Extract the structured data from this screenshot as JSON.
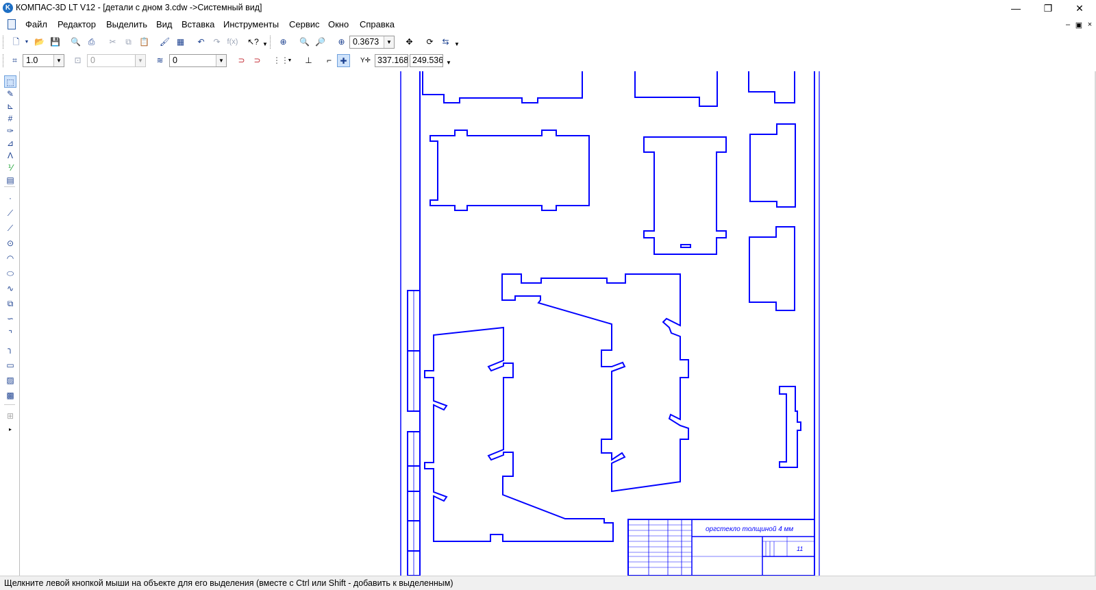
{
  "window": {
    "app_icon": "kompas-k-icon",
    "title": "КОМПАС-3D LT V12 - [детали с дном 3.cdw ->Системный вид]",
    "minimize": "—",
    "restore": "❐",
    "close": "✕"
  },
  "menu": {
    "items": [
      "Файл",
      "Редактор",
      "Выделить",
      "Вид",
      "Вставка",
      "Инструменты",
      "Сервис",
      "Окно",
      "Справка"
    ],
    "doc_controls": [
      "‒",
      "▣",
      "×"
    ]
  },
  "toolbar1": {
    "zoom_value": "0.3673",
    "buttons": [
      "new-document",
      "open",
      "save",
      "print-preview",
      "print",
      "cut",
      "copy",
      "paste",
      "format-painter",
      "variables",
      "undo",
      "redo",
      "function",
      "help-pointer",
      "zoom-window",
      "zoom-in",
      "zoom-out",
      "zoom-scale",
      "pan",
      "refresh-view",
      "rebuild"
    ]
  },
  "toolbar2": {
    "step_value": "1.0",
    "angle_value": "0",
    "layer_value": "0",
    "coord_x": "337.168",
    "coord_y": "249.536",
    "buttons": [
      "step-cursor",
      "layer",
      "current-layer",
      "snap-global",
      "snap-local",
      "grid",
      "ortho",
      "local-cs",
      "round",
      "snap-active"
    ]
  },
  "left_toolbar": {
    "tools": [
      "select",
      "geometry",
      "dimensions",
      "designations",
      "edit",
      "parametrization",
      "measure",
      "filter",
      "spec",
      "point",
      "auxiliary-line",
      "segment",
      "circle",
      "arc",
      "ellipse",
      "nurbs",
      "polyline",
      "bezier",
      "chamfer",
      "fillet",
      "rectangle",
      "hatch",
      "fill",
      "disabled-tool"
    ]
  },
  "drawing": {
    "title_block_note": "оргстекло толщиной 4 мм",
    "sheet_number": "11",
    "line_color": "#0000ff"
  },
  "status": {
    "hint": "Щелкните левой кнопкой мыши на объекте для его выделения (вместе с Ctrl или Shift - добавить к выделенным)"
  }
}
